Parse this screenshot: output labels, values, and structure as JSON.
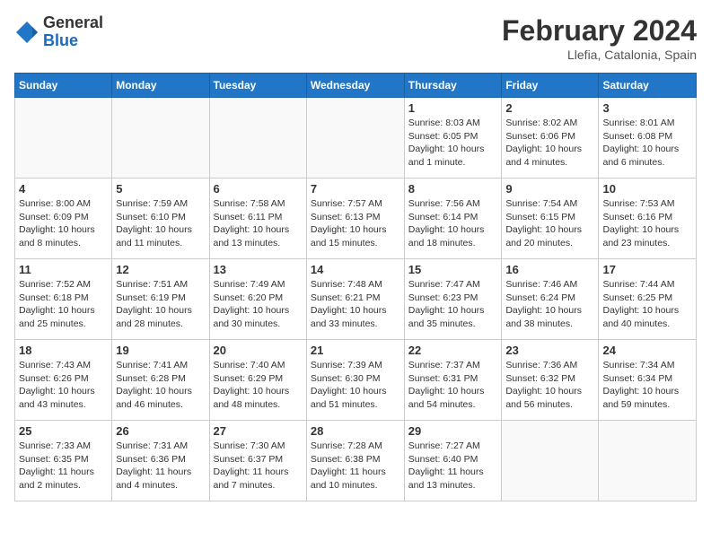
{
  "header": {
    "logo_general": "General",
    "logo_blue": "Blue",
    "month_year": "February 2024",
    "location": "Llefia, Catalonia, Spain"
  },
  "weekdays": [
    "Sunday",
    "Monday",
    "Tuesday",
    "Wednesday",
    "Thursday",
    "Friday",
    "Saturday"
  ],
  "weeks": [
    [
      {
        "day": "",
        "info": ""
      },
      {
        "day": "",
        "info": ""
      },
      {
        "day": "",
        "info": ""
      },
      {
        "day": "",
        "info": ""
      },
      {
        "day": "1",
        "info": "Sunrise: 8:03 AM\nSunset: 6:05 PM\nDaylight: 10 hours\nand 1 minute."
      },
      {
        "day": "2",
        "info": "Sunrise: 8:02 AM\nSunset: 6:06 PM\nDaylight: 10 hours\nand 4 minutes."
      },
      {
        "day": "3",
        "info": "Sunrise: 8:01 AM\nSunset: 6:08 PM\nDaylight: 10 hours\nand 6 minutes."
      }
    ],
    [
      {
        "day": "4",
        "info": "Sunrise: 8:00 AM\nSunset: 6:09 PM\nDaylight: 10 hours\nand 8 minutes."
      },
      {
        "day": "5",
        "info": "Sunrise: 7:59 AM\nSunset: 6:10 PM\nDaylight: 10 hours\nand 11 minutes."
      },
      {
        "day": "6",
        "info": "Sunrise: 7:58 AM\nSunset: 6:11 PM\nDaylight: 10 hours\nand 13 minutes."
      },
      {
        "day": "7",
        "info": "Sunrise: 7:57 AM\nSunset: 6:13 PM\nDaylight: 10 hours\nand 15 minutes."
      },
      {
        "day": "8",
        "info": "Sunrise: 7:56 AM\nSunset: 6:14 PM\nDaylight: 10 hours\nand 18 minutes."
      },
      {
        "day": "9",
        "info": "Sunrise: 7:54 AM\nSunset: 6:15 PM\nDaylight: 10 hours\nand 20 minutes."
      },
      {
        "day": "10",
        "info": "Sunrise: 7:53 AM\nSunset: 6:16 PM\nDaylight: 10 hours\nand 23 minutes."
      }
    ],
    [
      {
        "day": "11",
        "info": "Sunrise: 7:52 AM\nSunset: 6:18 PM\nDaylight: 10 hours\nand 25 minutes."
      },
      {
        "day": "12",
        "info": "Sunrise: 7:51 AM\nSunset: 6:19 PM\nDaylight: 10 hours\nand 28 minutes."
      },
      {
        "day": "13",
        "info": "Sunrise: 7:49 AM\nSunset: 6:20 PM\nDaylight: 10 hours\nand 30 minutes."
      },
      {
        "day": "14",
        "info": "Sunrise: 7:48 AM\nSunset: 6:21 PM\nDaylight: 10 hours\nand 33 minutes."
      },
      {
        "day": "15",
        "info": "Sunrise: 7:47 AM\nSunset: 6:23 PM\nDaylight: 10 hours\nand 35 minutes."
      },
      {
        "day": "16",
        "info": "Sunrise: 7:46 AM\nSunset: 6:24 PM\nDaylight: 10 hours\nand 38 minutes."
      },
      {
        "day": "17",
        "info": "Sunrise: 7:44 AM\nSunset: 6:25 PM\nDaylight: 10 hours\nand 40 minutes."
      }
    ],
    [
      {
        "day": "18",
        "info": "Sunrise: 7:43 AM\nSunset: 6:26 PM\nDaylight: 10 hours\nand 43 minutes."
      },
      {
        "day": "19",
        "info": "Sunrise: 7:41 AM\nSunset: 6:28 PM\nDaylight: 10 hours\nand 46 minutes."
      },
      {
        "day": "20",
        "info": "Sunrise: 7:40 AM\nSunset: 6:29 PM\nDaylight: 10 hours\nand 48 minutes."
      },
      {
        "day": "21",
        "info": "Sunrise: 7:39 AM\nSunset: 6:30 PM\nDaylight: 10 hours\nand 51 minutes."
      },
      {
        "day": "22",
        "info": "Sunrise: 7:37 AM\nSunset: 6:31 PM\nDaylight: 10 hours\nand 54 minutes."
      },
      {
        "day": "23",
        "info": "Sunrise: 7:36 AM\nSunset: 6:32 PM\nDaylight: 10 hours\nand 56 minutes."
      },
      {
        "day": "24",
        "info": "Sunrise: 7:34 AM\nSunset: 6:34 PM\nDaylight: 10 hours\nand 59 minutes."
      }
    ],
    [
      {
        "day": "25",
        "info": "Sunrise: 7:33 AM\nSunset: 6:35 PM\nDaylight: 11 hours\nand 2 minutes."
      },
      {
        "day": "26",
        "info": "Sunrise: 7:31 AM\nSunset: 6:36 PM\nDaylight: 11 hours\nand 4 minutes."
      },
      {
        "day": "27",
        "info": "Sunrise: 7:30 AM\nSunset: 6:37 PM\nDaylight: 11 hours\nand 7 minutes."
      },
      {
        "day": "28",
        "info": "Sunrise: 7:28 AM\nSunset: 6:38 PM\nDaylight: 11 hours\nand 10 minutes."
      },
      {
        "day": "29",
        "info": "Sunrise: 7:27 AM\nSunset: 6:40 PM\nDaylight: 11 hours\nand 13 minutes."
      },
      {
        "day": "",
        "info": ""
      },
      {
        "day": "",
        "info": ""
      }
    ]
  ]
}
